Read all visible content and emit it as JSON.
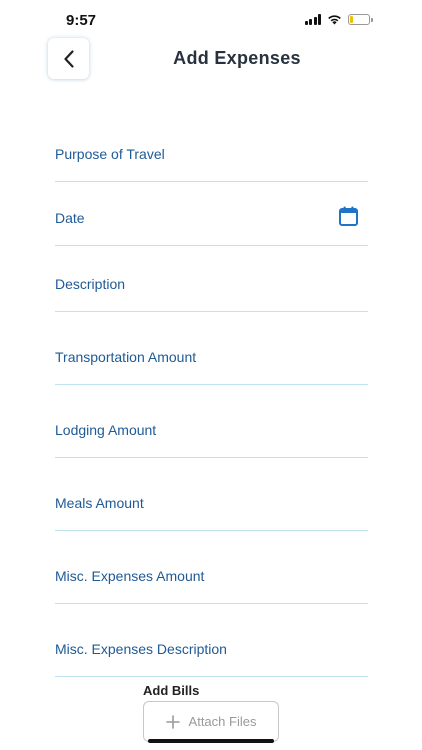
{
  "status_bar": {
    "time": "9:57",
    "battery_level": 0.15,
    "battery_color": "#f2c200"
  },
  "header": {
    "back_icon": "chevron-left-icon",
    "title": "Add Expenses"
  },
  "form": {
    "label_color": "#1f5a96",
    "underline_color": "#bfe3f1",
    "fields": [
      {
        "label": "Purpose of Travel"
      },
      {
        "label": "Date",
        "icon": "calendar-icon"
      },
      {
        "label": "Description"
      },
      {
        "label": "Transportation Amount"
      },
      {
        "label": "Lodging Amount"
      },
      {
        "label": "Meals Amount"
      },
      {
        "label": "Misc. Expenses Amount"
      },
      {
        "label": "Misc. Expenses Description"
      }
    ]
  },
  "bills": {
    "label": "Add Bills",
    "attach_icon": "plus-icon",
    "attach_label": "Attach Files"
  }
}
